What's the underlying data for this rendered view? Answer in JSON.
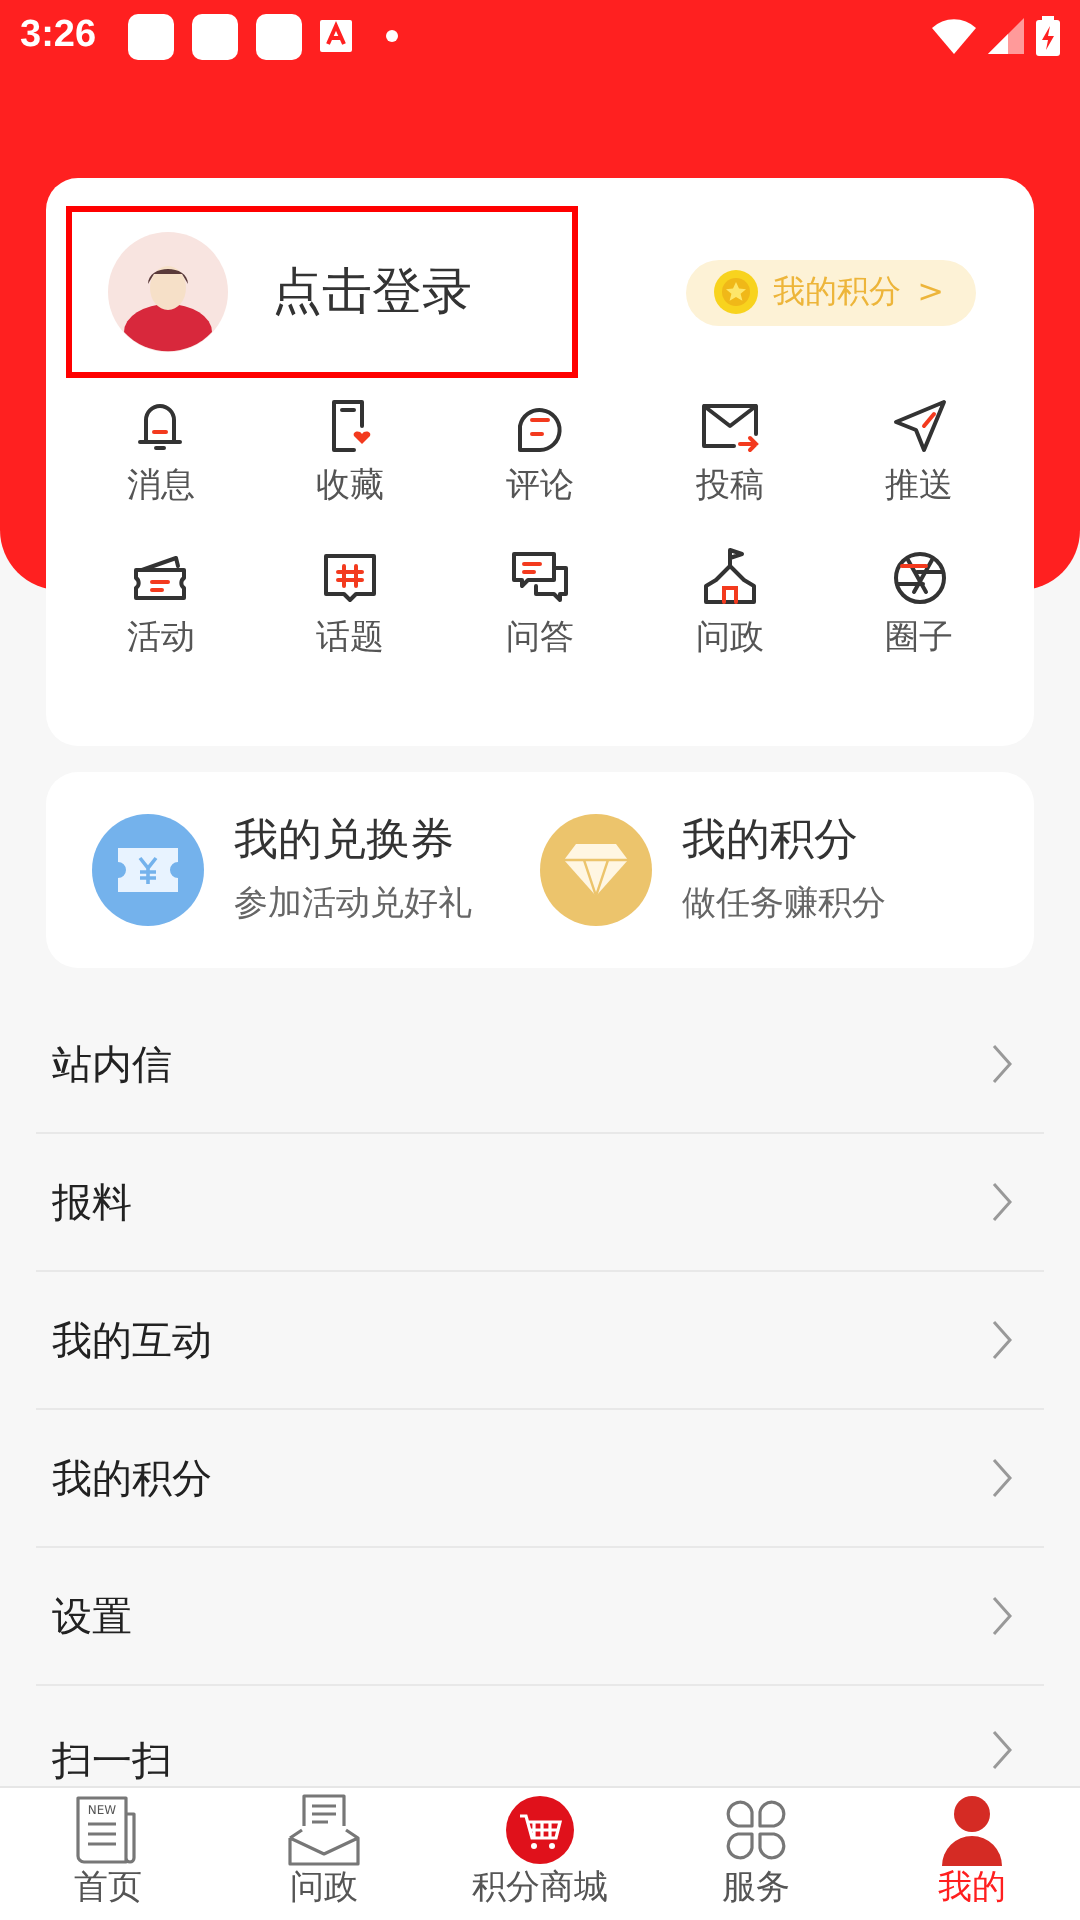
{
  "status_bar": {
    "time": "3:26"
  },
  "profile": {
    "login_label": "点击登录",
    "points_badge": {
      "label": "我的积分",
      "arrow": ">"
    }
  },
  "shortcuts": [
    {
      "label": "消息",
      "kind": "bell"
    },
    {
      "label": "收藏",
      "kind": "bookmark"
    },
    {
      "label": "评论",
      "kind": "comment"
    },
    {
      "label": "投稿",
      "kind": "mail"
    },
    {
      "label": "推送",
      "kind": "send"
    },
    {
      "label": "活动",
      "kind": "ticket"
    },
    {
      "label": "话题",
      "kind": "topic"
    },
    {
      "label": "问答",
      "kind": "qa"
    },
    {
      "label": "问政",
      "kind": "hall"
    },
    {
      "label": "圈子",
      "kind": "aperture"
    }
  ],
  "rewards": [
    {
      "title": "我的兑换券",
      "subtitle": "参加活动兑好礼",
      "kind": "coupon",
      "color": "#74b2ec"
    },
    {
      "title": "我的积分",
      "subtitle": "做任务赚积分",
      "kind": "diamond",
      "color": "#ecc46c"
    }
  ],
  "menu": [
    "站内信",
    "报料",
    "我的互动",
    "我的积分",
    "设置",
    "扫一扫"
  ],
  "tab_bar": [
    {
      "label": "首页",
      "kind": "news",
      "icon_text": "NEW",
      "selected": false
    },
    {
      "label": "问政",
      "kind": "letter",
      "selected": false
    },
    {
      "label": "积分商城",
      "kind": "cart",
      "selected": false
    },
    {
      "label": "服务",
      "kind": "clover",
      "selected": false
    },
    {
      "label": "我的",
      "kind": "person",
      "selected": true
    }
  ]
}
